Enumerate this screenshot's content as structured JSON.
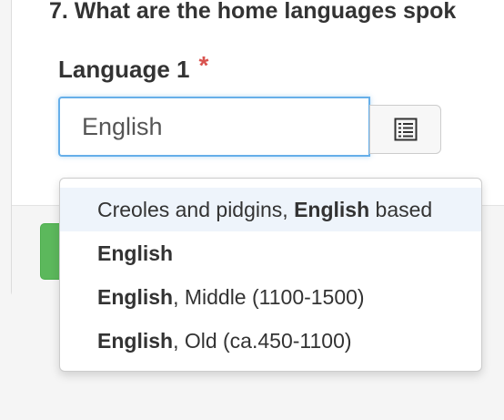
{
  "question": {
    "text": "7. What are the home languages spok"
  },
  "field": {
    "label": "Language 1",
    "required_mark": "*",
    "value": "English"
  },
  "icons": {
    "list_button": "list-icon"
  },
  "colors": {
    "required": "#d9534f",
    "focus_border": "#66afe9",
    "success": "#5cb85c",
    "highlight": "#eef4fb"
  },
  "dropdown": {
    "options": [
      {
        "pre": "Creoles and pidgins, ",
        "match": "English",
        "post": " based",
        "highlighted": true
      },
      {
        "pre": "",
        "match": "English",
        "post": "",
        "highlighted": false
      },
      {
        "pre": "",
        "match": "English",
        "post": ", Middle (1100-1500)",
        "highlighted": false
      },
      {
        "pre": "",
        "match": "English",
        "post": ", Old (ca.450-1100)",
        "highlighted": false
      }
    ]
  }
}
